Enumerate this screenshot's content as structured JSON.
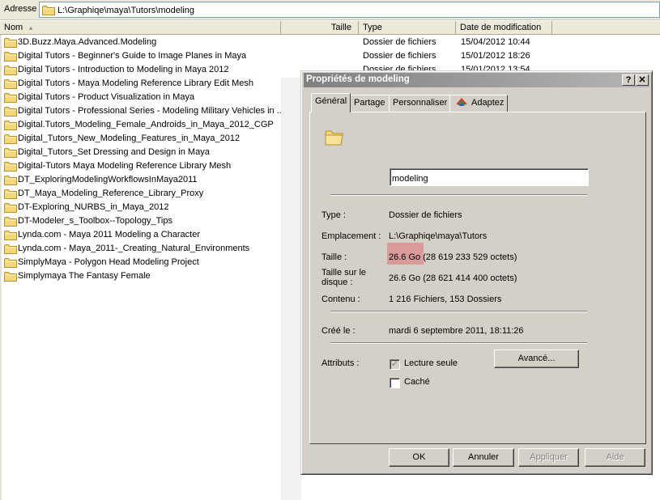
{
  "address": {
    "label": "Adresse",
    "path": "L:\\Graphiqe\\maya\\Tutors\\modeling"
  },
  "columns": {
    "name": "Nom",
    "size": "Taille",
    "type": "Type",
    "date": "Date de modification"
  },
  "files": [
    {
      "name": "3D.Buzz.Maya.Advanced.Modeling",
      "type": "Dossier de fichiers",
      "date": "15/04/2012 10:44"
    },
    {
      "name": "Digital Tutors - Beginner's Guide to Image Planes in Maya",
      "type": "Dossier de fichiers",
      "date": "15/01/2012 18:26"
    },
    {
      "name": "Digital Tutors - Introduction to Modeling in Maya 2012",
      "type": "Dossier de fichiers",
      "date": "15/01/2012 13:54"
    },
    {
      "name": "Digital Tutors - Maya Modeling Reference Library Edit Mesh"
    },
    {
      "name": "Digital Tutors - Product Visualization in Maya"
    },
    {
      "name": "Digital Tutors - Professional Series - Modeling Military Vehicles in ..."
    },
    {
      "name": "Digital.Tutors_Modeling_Female_Androids_in_Maya_2012_CGP"
    },
    {
      "name": "Digital_Tutors_New_Modeling_Features_in_Maya_2012"
    },
    {
      "name": "Digital_Tutors_Set Dressing and Design in Maya"
    },
    {
      "name": "Digital-Tutors  Maya Modeling Reference Library Mesh"
    },
    {
      "name": "DT_ExploringModelingWorkflowsInMaya2011"
    },
    {
      "name": "DT_Maya_Modeling_Reference_Library_Proxy"
    },
    {
      "name": "DT-Exploring_NURBS_in_Maya_2012"
    },
    {
      "name": "DT-Modeler_s_Toolbox--Topology_Tips"
    },
    {
      "name": "Lynda.com - Maya 2011 Modeling a Character"
    },
    {
      "name": "Lynda.com - Maya_2011-_Creating_Natural_Environments"
    },
    {
      "name": "SimplyMaya - Polygon Head Modeling Project"
    },
    {
      "name": "Simplymaya The Fantasy Female"
    }
  ],
  "dialog": {
    "title": "Propriétés de modeling",
    "help_button": "?",
    "close_button": "✕",
    "tabs": [
      "Général",
      "Partage",
      "Personnaliser",
      "Adaptez"
    ],
    "name_value": "modeling",
    "type_label": "Type :",
    "type_value": "Dossier de fichiers",
    "location_label": "Emplacement :",
    "location_value": "L:\\Graphiqe\\maya\\Tutors",
    "size_label": "Taille :",
    "size_value": "26.6 Go (28 619 233 529 octets)",
    "disk_size_label_line1": "Taille sur le",
    "disk_size_label_line2": "disque :",
    "disk_size_value": "26.6 Go (28 621 414 400 octets)",
    "contents_label": "Contenu :",
    "contents_value": "1 216 Fichiers, 153 Dossiers",
    "created_label": "Créé le :",
    "created_value": "mardi 6 septembre 2011, 18:11:26",
    "attributes_label": "Attributs :",
    "readonly_label": "Lecture seule",
    "hidden_label": "Caché",
    "advanced_button": "Avancé...",
    "ok_button": "OK",
    "cancel_button": "Annuler",
    "apply_button": "Appliquer",
    "help_bottom_button": "Aide",
    "highlight_color": "#d99a9a"
  }
}
